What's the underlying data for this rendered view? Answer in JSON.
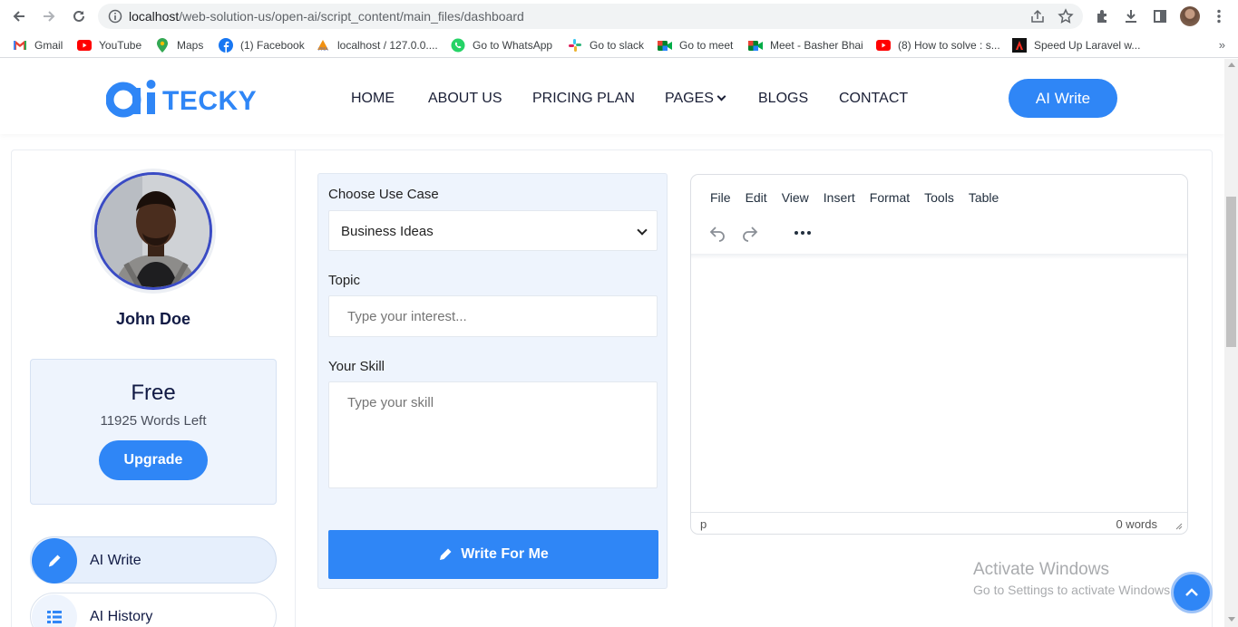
{
  "browser": {
    "url_host": "localhost",
    "url_path": "/web-solution-us/open-ai/script_content/main_files/dashboard",
    "bookmarks": [
      {
        "label": "Gmail",
        "icon": "gmail-icon"
      },
      {
        "label": "YouTube",
        "icon": "youtube-icon"
      },
      {
        "label": "Maps",
        "icon": "maps-icon"
      },
      {
        "label": "(1) Facebook",
        "icon": "facebook-icon"
      },
      {
        "label": "localhost / 127.0.0....",
        "icon": "phpmyadmin-icon"
      },
      {
        "label": "Go to WhatsApp",
        "icon": "whatsapp-icon"
      },
      {
        "label": "Go to slack",
        "icon": "slack-icon"
      },
      {
        "label": "Go to meet",
        "icon": "meet-icon"
      },
      {
        "label": "Meet - Basher Bhai",
        "icon": "meet-icon"
      },
      {
        "label": "(8) How to solve : s...",
        "icon": "youtube-icon"
      },
      {
        "label": "Speed Up Laravel w...",
        "icon": "laravel-icon"
      }
    ],
    "more": "»"
  },
  "header": {
    "logo_text": "TECKY",
    "menu": [
      "HOME",
      "ABOUT US",
      "PRICING PLAN",
      "PAGES",
      "BLOGS",
      "CONTACT"
    ],
    "cta_label": "AI Write"
  },
  "sidebar": {
    "user_name": "John Doe",
    "plan": {
      "name": "Free",
      "words_left": "11925 Words Left",
      "upgrade_label": "Upgrade"
    },
    "items": [
      {
        "label": "AI Write",
        "icon": "pen-icon",
        "active": true
      },
      {
        "label": "AI History",
        "icon": "list-icon",
        "active": false
      }
    ]
  },
  "form": {
    "use_case_label": "Choose Use Case",
    "use_case_value": "Business Ideas",
    "topic_label": "Topic",
    "topic_placeholder": "Type your interest...",
    "skill_label": "Your Skill",
    "skill_placeholder": "Type your skill",
    "submit_label": "Write For Me"
  },
  "editor": {
    "menus": [
      "File",
      "Edit",
      "View",
      "Insert",
      "Format",
      "Tools",
      "Table"
    ],
    "path": "p",
    "word_count": "0 words"
  },
  "watermark": {
    "line1": "Activate Windows",
    "line2": "Go to Settings to activate Windows."
  },
  "colors": {
    "primary": "#2f86f6",
    "panel": "#eef4fd",
    "text_dark": "#111a44"
  }
}
